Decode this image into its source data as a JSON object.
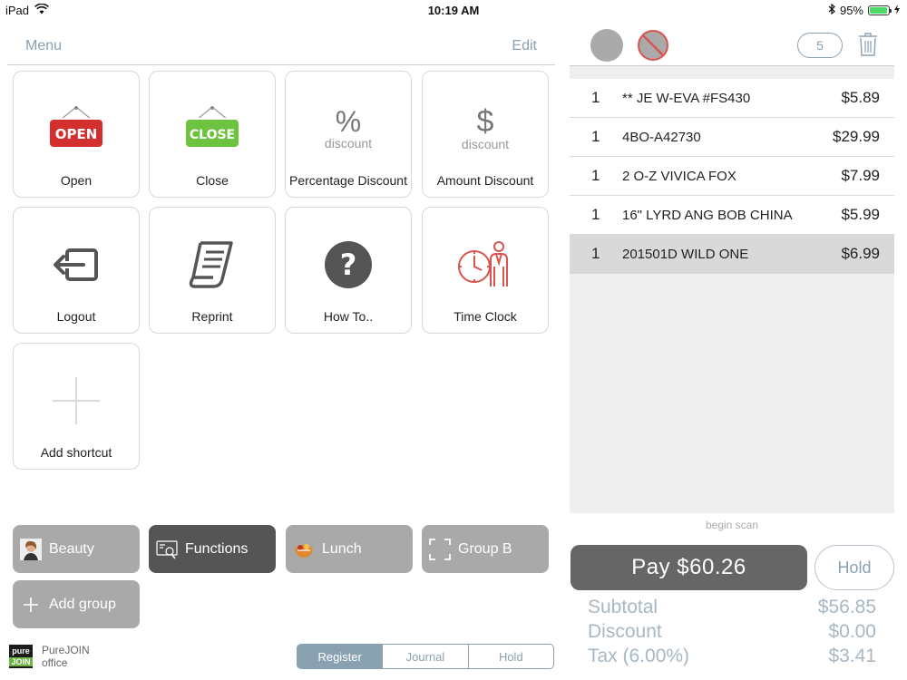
{
  "status_bar": {
    "device": "iPad",
    "time": "10:19 AM",
    "battery": "95%"
  },
  "menu": {
    "title": "Menu",
    "edit_label": "Edit"
  },
  "shortcuts": [
    {
      "label": "Open",
      "icon": "open-sign-icon",
      "badge_text": "OPEN"
    },
    {
      "label": "Close",
      "icon": "close-sign-icon",
      "badge_text": "CLOSE"
    },
    {
      "label": "Percentage Discount",
      "icon": "percent-discount-icon",
      "symbol": "%",
      "caption": "discount"
    },
    {
      "label": "Amount Discount",
      "icon": "dollar-discount-icon",
      "symbol": "$",
      "caption": "discount"
    },
    {
      "label": "Logout",
      "icon": "logout-icon"
    },
    {
      "label": "Reprint",
      "icon": "receipt-icon"
    },
    {
      "label": "How To..",
      "icon": "question-icon",
      "symbol": "?"
    },
    {
      "label": "Time Clock",
      "icon": "time-clock-icon"
    },
    {
      "label": "Add shortcut",
      "icon": "plus-icon"
    }
  ],
  "groups": [
    {
      "label": "Beauty",
      "icon": "beauty-avatar-icon"
    },
    {
      "label": "Functions",
      "icon": "functions-icon"
    },
    {
      "label": "Lunch",
      "icon": "lunch-icon"
    },
    {
      "label": "Group B",
      "icon": "group-frame-icon"
    },
    {
      "label": "Add group",
      "icon": "plus-icon"
    }
  ],
  "brand": {
    "logo_top": "pure",
    "logo_bottom": "JOIN",
    "line1": "PureJOIN",
    "line2": "office"
  },
  "tabs": [
    {
      "label": "Register",
      "active": true
    },
    {
      "label": "Journal",
      "active": false
    },
    {
      "label": "Hold",
      "active": false
    }
  ],
  "cart": {
    "item_count": "5",
    "items": [
      {
        "qty": "1",
        "name": "** JE W-EVA #FS430",
        "price": "$5.89",
        "selected": false
      },
      {
        "qty": "1",
        "name": "4BO-A42730",
        "price": "$29.99",
        "selected": false
      },
      {
        "qty": "1",
        "name": "2 O-Z VIVICA FOX",
        "price": "$7.99",
        "selected": false
      },
      {
        "qty": "1",
        "name": "16\" LYRD ANG BOB CHINA",
        "price": "$5.99",
        "selected": false
      },
      {
        "qty": "1",
        "name": "201501D WILD ONE",
        "price": "$6.99",
        "selected": true
      }
    ],
    "scan_hint": "begin scan"
  },
  "checkout": {
    "pay_label": "Pay $60.26",
    "hold_label": "Hold",
    "subtotal_label": "Subtotal",
    "subtotal_value": "$56.85",
    "discount_label": "Discount",
    "discount_value": "$0.00",
    "tax_label": "Tax (6.00%)",
    "tax_value": "$3.41"
  },
  "colors": {
    "accent": "#8aa1b1",
    "group_button": "#a9a9a9",
    "active_group": "#555555",
    "pay_button": "#666666",
    "open_red": "#d32f2f",
    "close_green": "#6cc33f"
  }
}
